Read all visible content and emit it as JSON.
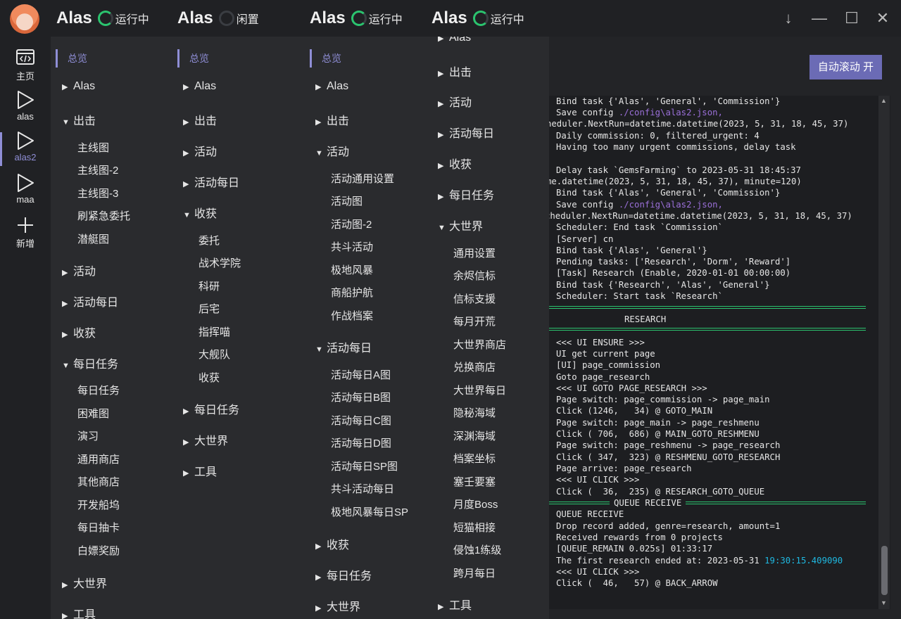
{
  "titlebar": {
    "instances": [
      {
        "name": "Alas",
        "status": "运行中",
        "running": true
      },
      {
        "name": "Alas",
        "status": "闲置",
        "running": false
      },
      {
        "name": "Alas",
        "status": "运行中",
        "running": true
      },
      {
        "name": "Alas",
        "status": "运行中",
        "running": true
      }
    ],
    "minimize": "—",
    "download": "↓",
    "maximize": "☐",
    "close": "✕"
  },
  "rail": {
    "home": "主页",
    "alas": "alas",
    "alas2": "alas2",
    "maa": "maa",
    "add": "新增"
  },
  "menu": {
    "col1": {
      "section": "总览",
      "alas": "Alas",
      "chuji": "出击",
      "chuji_items": [
        "主线图",
        "主线图-2",
        "主线图-3",
        "刷紧急委托",
        "潜艇图"
      ],
      "huodong": "活动",
      "huodong_daily": "活动每日",
      "shouhuo": "收获",
      "daily": "每日任务",
      "daily_items": [
        "每日任务",
        "困难图",
        "演习",
        "通用商店",
        "其他商店",
        "开发船坞",
        "每日抽卡",
        "白嫖奖励"
      ],
      "world": "大世界",
      "tools": "工具"
    },
    "col2": {
      "section": "总览",
      "alas": "Alas",
      "chuji": "出击",
      "huodong": "活动",
      "huodong_daily": "活动每日",
      "shouhuo": "收获",
      "shouhuo_items": [
        "委托",
        "战术学院",
        "科研",
        "后宅",
        "指挥喵",
        "大舰队",
        "收获"
      ],
      "daily": "每日任务",
      "world": "大世界",
      "tools": "工具"
    },
    "col3": {
      "section": "总览",
      "alas": "Alas",
      "chuji": "出击",
      "huodong": "活动",
      "huodong_items": [
        "活动通用设置",
        "活动图",
        "活动图-2",
        "共斗活动",
        "极地风暴",
        "商船护航",
        "作战档案"
      ],
      "huodong_daily": "活动每日",
      "huodong_daily_items": [
        "活动每日A图",
        "活动每日B图",
        "活动每日C图",
        "活动每日D图",
        "活动每日SP图",
        "共斗活动每日",
        "极地风暴每日SP"
      ],
      "shouhuo": "收获",
      "daily": "每日任务",
      "world": "大世界"
    },
    "col4": {
      "alas": "Alas",
      "chuji": "出击",
      "huodong": "活动",
      "huodong_daily": "活动每日",
      "shouhuo": "收获",
      "daily": "每日任务",
      "world": "大世界",
      "world_items": [
        "通用设置",
        "余烬信标",
        "信标支援",
        "每月开荒",
        "大世界商店",
        "兑换商店",
        "大世界每日",
        "隐秘海域",
        "深渊海域",
        "档案坐标",
        "塞壬要塞",
        "月度Boss",
        "短猫相接",
        "侵蚀1练级",
        "跨月每日"
      ],
      "tools": "工具"
    }
  },
  "log": {
    "autoscroll": "自动滚动 开",
    "lines": [
      "Bind task {'Alas', 'General', 'Commission'}",
      "Save config ",
      "heduler.NextRun=datetime.datetime(2023, 5, 31, 18, 45, 37)",
      "Daily commission: 0, filtered_urgent: 4",
      "Having too many urgent commissions, delay task",
      "",
      "Delay task `GemsFarming` to 2023-05-31 18:45:37",
      "me.datetime(2023, 5, 31, 18, 45, 37), minute=120)",
      "Bind task {'Alas', 'General', 'Commission'}",
      "Save config ",
      "cheduler.NextRun=datetime.datetime(2023, 5, 31, 18, 45, 37)",
      "Scheduler: End task `Commission`",
      "[Server] cn",
      "Bind task {'Alas', 'General'}",
      "Pending tasks: ['Research', 'Dorm', 'Reward']",
      "[Task] Research (Enable, 2020-01-01 00:00:00)",
      "Bind task {'Research', 'Alas', 'General'}",
      "Scheduler: Start task `Research`"
    ],
    "config_path": "./config\\alas2.json,",
    "sep1_title": "RESEARCH",
    "lines2": [
      "<<< UI ENSURE >>>",
      "UI get current page",
      "[UI] page_commission",
      "Goto page_research",
      "<<< UI GOTO PAGE_RESEARCH >>>",
      "Page switch: page_commission -> page_main",
      "Click (1246,   34) @ GOTO_MAIN",
      "Page switch: page_main -> page_reshmenu",
      "Click ( 706,  686) @ MAIN_GOTO_RESHMENU",
      "Page switch: page_reshmenu -> page_research",
      "Click ( 347,  323) @ RESHMENU_GOTO_RESEARCH",
      "Page arrive: page_research",
      "<<< UI CLICK >>>",
      "Click (  36,  235) @ RESEARCH_GOTO_QUEUE"
    ],
    "sep2_title": "QUEUE RECEIVE",
    "lines3": [
      "QUEUE RECEIVE",
      "Drop record added, genre=research, amount=1",
      "Received rewards from 0 projects",
      "[QUEUE_REMAIN 0.025s] 01:33:17",
      "The first research ended at: 2023-05-31 ",
      "<<< UI CLICK >>>",
      "Click (  46,   57) @ BACK_ARROW"
    ],
    "research_time": "19:30:15.409090"
  },
  "colors": {
    "accent": "#8f8ed6",
    "running": "#2bc46f",
    "button": "#6b6bb5"
  }
}
